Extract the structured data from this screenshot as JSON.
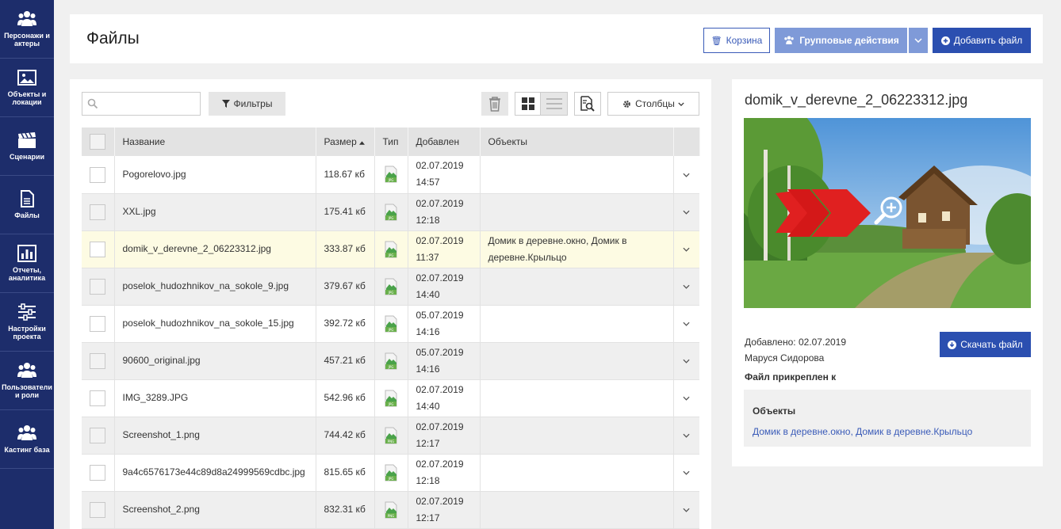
{
  "sidebar": {
    "items": [
      {
        "label": "Персонажи и актеры",
        "icon": "users-icon"
      },
      {
        "label": "Объекты и локации",
        "icon": "image-icon"
      },
      {
        "label": "Сценарии",
        "icon": "clapperboard-icon"
      },
      {
        "label": "Файлы",
        "icon": "document-icon"
      },
      {
        "label": "Отчеты, аналитика",
        "icon": "chart-icon"
      },
      {
        "label": "Настройки проекта",
        "icon": "sliders-icon"
      },
      {
        "label": "Пользователи и роли",
        "icon": "users-icon"
      },
      {
        "label": "Кастинг база",
        "icon": "users-icon"
      }
    ]
  },
  "header": {
    "title": "Файлы",
    "trash_label": "Корзина",
    "group_label": "Групповые действия",
    "add_label": "Добавить файл"
  },
  "toolbar": {
    "search_placeholder": "",
    "filter_label": "Фильтры",
    "columns_label": "Столбцы"
  },
  "table": {
    "headers": {
      "name": "Название",
      "size": "Размер",
      "type": "Тип",
      "added": "Добавлен",
      "objects": "Объекты"
    },
    "rows": [
      {
        "name": "Pogorelovo.jpg",
        "size": "118.67 кб",
        "type": "JPG",
        "date": "02.07.2019",
        "time": "14:57",
        "objects": ""
      },
      {
        "name": "XXL.jpg",
        "size": "175.41 кб",
        "type": "JPG",
        "date": "02.07.2019",
        "time": "12:18",
        "objects": ""
      },
      {
        "name": "domik_v_derevne_2_06223312.jpg",
        "size": "333.87 кб",
        "type": "JPG",
        "date": "02.07.2019",
        "time": "11:37",
        "objects": "Домик в деревне.окно, Домик в деревне.Крыльцо"
      },
      {
        "name": "poselok_hudozhnikov_na_sokole_9.jpg",
        "size": "379.67 кб",
        "type": "JPG",
        "date": "02.07.2019",
        "time": "14:40",
        "objects": ""
      },
      {
        "name": "poselok_hudozhnikov_na_sokole_15.jpg",
        "size": "392.72 кб",
        "type": "JPG",
        "date": "05.07.2019",
        "time": "14:16",
        "objects": ""
      },
      {
        "name": "90600_original.jpg",
        "size": "457.21 кб",
        "type": "JPG",
        "date": "05.07.2019",
        "time": "14:16",
        "objects": ""
      },
      {
        "name": "IMG_3289.JPG",
        "size": "542.96 кб",
        "type": "JPG",
        "date": "02.07.2019",
        "time": "14:40",
        "objects": ""
      },
      {
        "name": "Screenshot_1.png",
        "size": "744.42 кб",
        "type": "PNG",
        "date": "02.07.2019",
        "time": "12:17",
        "objects": ""
      },
      {
        "name": "9a4c6576173e44c89d8a24999569cdbc.jpg",
        "size": "815.65 кб",
        "type": "JPG",
        "date": "02.07.2019",
        "time": "12:18",
        "objects": ""
      },
      {
        "name": "Screenshot_2.png",
        "size": "832.31 кб",
        "type": "PNG",
        "date": "02.07.2019",
        "time": "12:17",
        "objects": ""
      }
    ]
  },
  "details": {
    "title": "domik_v_derevne_2_06223312.jpg",
    "added_line": "Добавлено: 02.07.2019",
    "author": "Маруся Сидорова",
    "download_label": "Скачать файл",
    "attached_label": "Файл прикреплен к",
    "objects_heading": "Объекты",
    "objects_link": "Домик в деревне.окно, Домик в деревне.Крыльцо"
  },
  "colors": {
    "sidebar_bg": "#1d2d6b",
    "primary": "#2b4fb0",
    "primary_light": "#7f9ad8",
    "highlight_row": "#fdfbe3",
    "link": "#3a5bb8"
  }
}
